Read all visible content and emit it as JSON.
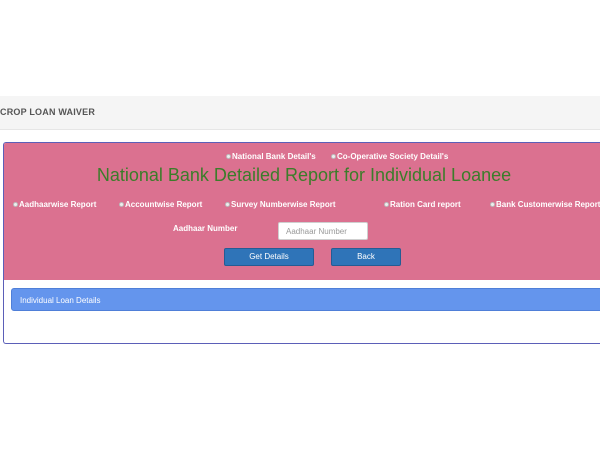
{
  "header": {
    "page_title": "CROP LOAN WAIVER"
  },
  "detail_type": {
    "options": [
      {
        "label": "National Bank Detail's",
        "selected": true
      },
      {
        "label": "Co-Operative Society Detail's",
        "selected": false
      }
    ]
  },
  "main": {
    "heading": "National Bank Detailed Report for Individual Loanee"
  },
  "report_type": {
    "options": [
      {
        "label": "Aadhaarwise Report",
        "selected": true
      },
      {
        "label": "Accountwise Report",
        "selected": false
      },
      {
        "label": "Survey Numberwise Report",
        "selected": false
      },
      {
        "label": "Ration Card report",
        "selected": false
      },
      {
        "label": "Bank Customerwise Report",
        "selected": false
      }
    ]
  },
  "form": {
    "aadhaar_label": "Aadhaar Number",
    "aadhaar_placeholder": "Aadhaar Number",
    "aadhaar_value": "",
    "get_details_label": "Get Details",
    "back_label": "Back"
  },
  "details_section": {
    "title": "Individual Loan Details"
  },
  "colors": {
    "panel_background": "#db7190",
    "heading_text": "#3b7d2a",
    "button": "#2f74b8",
    "section_bar": "#6495ed",
    "panel_border": "#5b5fb8"
  }
}
